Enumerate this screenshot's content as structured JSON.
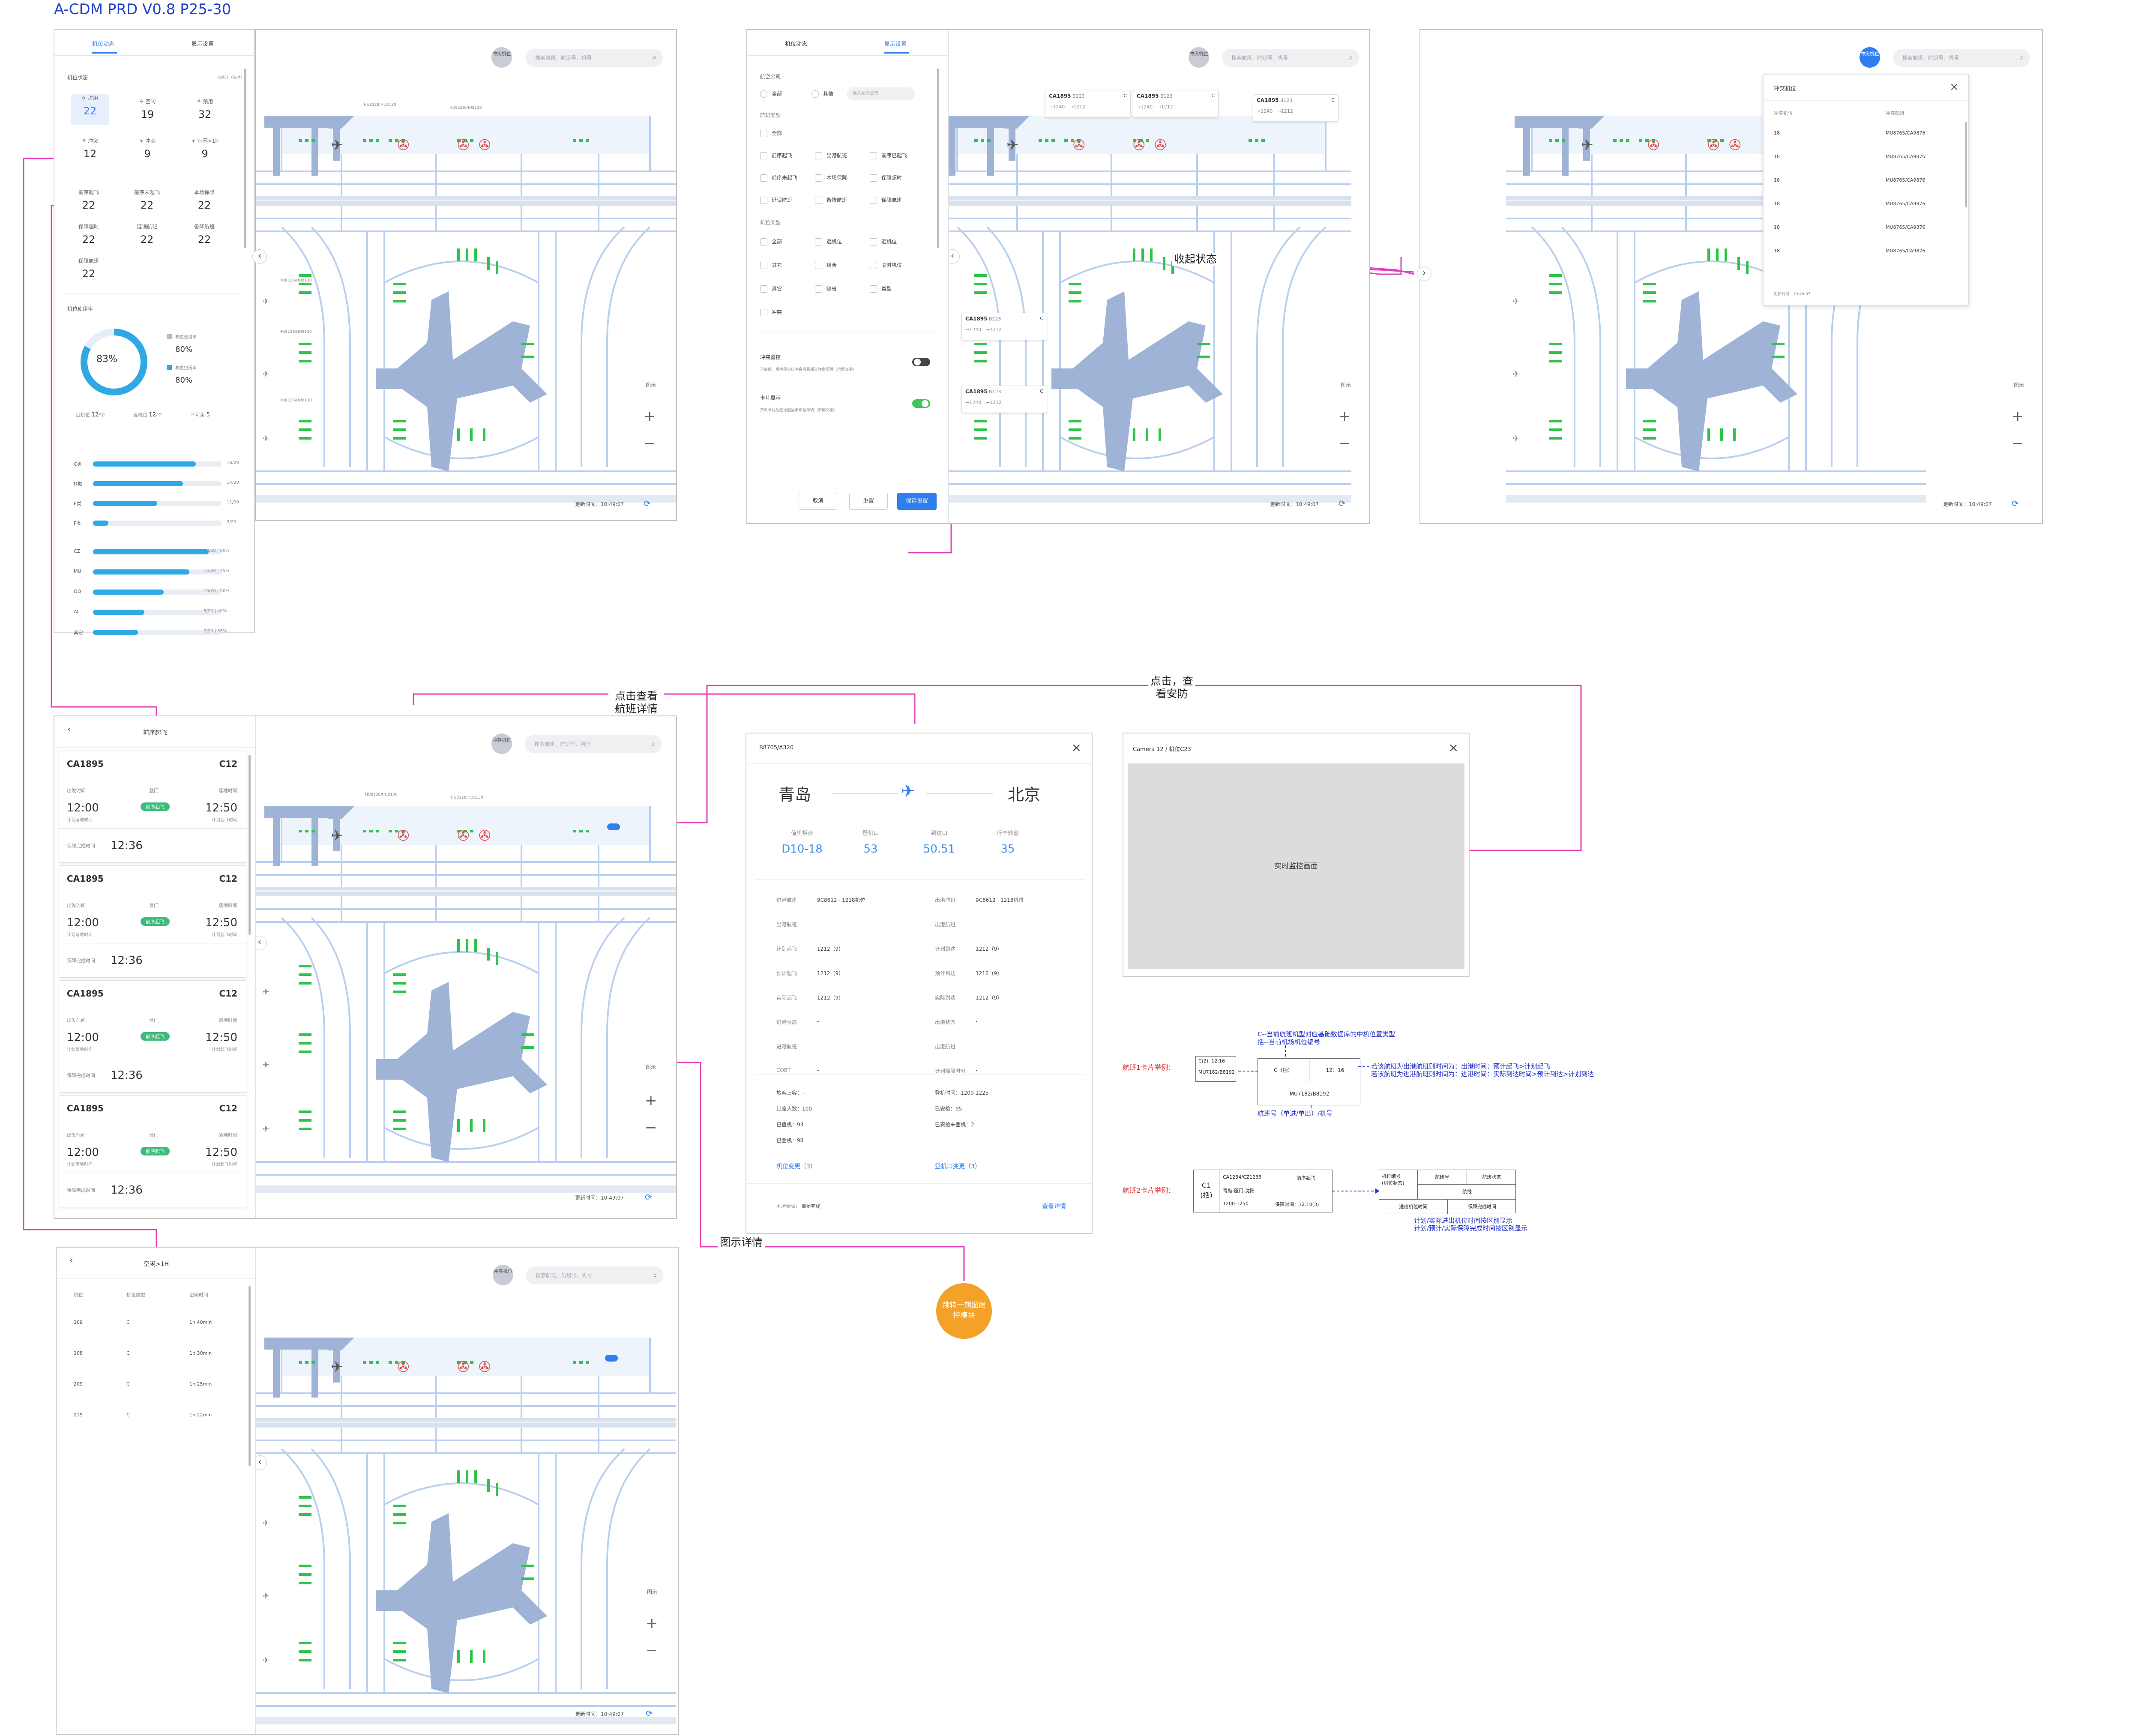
{
  "page_title": "A-CDM PRD V0.8  P25-30",
  "common": {
    "search_placeholder": "搜索航班、航班号、机号",
    "avatar": "冲突机位",
    "legend": "图示",
    "zoom_in": "+",
    "zoom_out": "−",
    "update_label": "更新时间：10:49:07",
    "collapse": "‹",
    "expand": "›"
  },
  "map_labels": [
    "HU8128/HU8130",
    "HU8128/HU8130",
    "HU8128/HU8130",
    "HU8128/HU8130",
    "HU8128/HU8130",
    "HU8128/HU8130",
    "HU8128/HU8130"
  ],
  "panel1": {
    "tabs": [
      "机位动态",
      "显示设置"
    ],
    "section1": "机位状态",
    "section1_hint": "仅统计（实时）",
    "stand_stats": [
      {
        "label": "占用",
        "value": "22",
        "active": true
      },
      {
        "label": "空闲",
        "value": "19"
      },
      {
        "label": "预用",
        "value": "32"
      },
      {
        "label": "冲突",
        "value": "12"
      },
      {
        "label": "冲突",
        "value": "9"
      },
      {
        "label": "空闲>1h",
        "value": "9"
      }
    ],
    "flight_stats": [
      {
        "label": "前序起飞",
        "value": "22"
      },
      {
        "label": "前序未起飞",
        "value": "22"
      },
      {
        "label": "本场保障",
        "value": "22"
      },
      {
        "label": "保障超时",
        "value": "22"
      },
      {
        "label": "延误航班",
        "value": "22"
      },
      {
        "label": "备降航班",
        "value": "22"
      },
      {
        "label": "保障航班",
        "value": "22"
      }
    ],
    "usage_title": "机位使用率",
    "usage_pct": "83%",
    "usage_fraction": 0.83,
    "legend_a_label": "机位使用率",
    "legend_a_value": "80%",
    "legend_b_label": "机位空闲率",
    "legend_b_value": "80%",
    "counts": [
      {
        "label": "近机位",
        "value": "12"
      },
      {
        "label": "远机位",
        "value": "12"
      },
      {
        "label": "不可用",
        "value": "5"
      }
    ],
    "counts_unit": "/个",
    "types": [
      {
        "name": "C类",
        "value": "16/20",
        "fraction": 0.8
      },
      {
        "name": "D类",
        "value": "14/20",
        "fraction": 0.7
      },
      {
        "name": "E类",
        "value": "11/20",
        "fraction": 0.5
      },
      {
        "name": "F类",
        "value": "3/20",
        "fraction": 0.12
      }
    ],
    "airlines": [
      {
        "name": "CZ",
        "value": "18/20 | 90%",
        "fraction": 0.9
      },
      {
        "name": "MU",
        "value": "15/20 | 75%",
        "fraction": 0.75
      },
      {
        "name": "OQ",
        "value": "10/20 | 50%",
        "fraction": 0.55
      },
      {
        "name": "AI",
        "value": "8/20 | 40%",
        "fraction": 0.4
      },
      {
        "name": "其它",
        "value": "7/20 | 35%",
        "fraction": 0.35
      }
    ]
  },
  "panel2": {
    "tabs": [
      "机位动态",
      "显示设置"
    ],
    "airline_label": "航空公司",
    "airline_opts": [
      "全部",
      "其他"
    ],
    "airline_input": "输入航空公司",
    "flight_type_label": "航班类型",
    "flight_opts": [
      "全部",
      "前序起飞",
      "出港航班",
      "前序已起飞",
      "前序未起飞",
      "本场保障",
      "保障超时",
      "延误航班",
      "备降航班",
      "保障航班"
    ],
    "stand_type_label": "机位类型",
    "stand_opts": [
      "全部",
      "远机位",
      "近机位",
      "其它",
      "组合",
      "临时机位",
      "其它",
      "缺省",
      "类型",
      "冲突"
    ],
    "conflict_label": "冲突监控",
    "conflict_desc": "开启后，当检测机位冲突后将通过弹窗提醒（示例文字）",
    "card_label": "卡片显示",
    "card_desc": "开启卡片后在地图显示机位详情（示例文案）",
    "btn_cancel": "取消",
    "btn_reset": "重置",
    "btn_save": "保存设置"
  },
  "flight_popups": [
    {
      "flight": "CA1895",
      "sub": "B123",
      "gate": "C",
      "a": "1240",
      "b": "1212"
    },
    {
      "flight": "CA1895",
      "sub": "B123",
      "gate": "C",
      "a": "1240",
      "b": "1212"
    },
    {
      "flight": "CA1895",
      "sub": "B123",
      "gate": "C",
      "a": "1240",
      "b": "1212"
    },
    {
      "flight": "CA1895",
      "sub": "B123",
      "gate": "C",
      "a": "1240",
      "b": "1212"
    },
    {
      "flight": "CA1895",
      "sub": "B123",
      "gate": "C",
      "a": "1240",
      "b": "1212"
    }
  ],
  "note_collapse": "收起状态",
  "conflict_dialog": {
    "title": "冲突机位",
    "headers": [
      "冲突机位",
      "冲突航班"
    ],
    "rows": [
      [
        "18",
        "MU8765/CA9876"
      ],
      [
        "18",
        "MU8765/CA9876"
      ],
      [
        "18",
        "MU8765/CA9876"
      ],
      [
        "18",
        "MU8765/CA9876"
      ],
      [
        "18",
        "MU8765/CA9876"
      ],
      [
        "18",
        "MU8765/CA9876"
      ]
    ],
    "footer": "更新时间：10:49:07"
  },
  "panel3": {
    "title": "前序起飞",
    "cards": [
      {
        "flight": "CA1895",
        "gate": "C12",
        "l1": "出发时间",
        "l2": "登门",
        "l3": "落地时间",
        "t1": "12:00",
        "t2": "12:50",
        "status": "前序起飞",
        "s1": "计划落地时间",
        "s2": "计划起飞时间",
        "el": "保障完成时间",
        "ev": "12:36"
      },
      {
        "flight": "CA1895",
        "gate": "C12",
        "l1": "出发时间",
        "l2": "登门",
        "l3": "落地时间",
        "t1": "12:00",
        "t2": "12:50",
        "status": "前序起飞",
        "s1": "计划落地时间",
        "s2": "计划起飞时间",
        "el": "保障完成时间",
        "ev": "12:36"
      },
      {
        "flight": "CA1895",
        "gate": "C12",
        "l1": "出发时间",
        "l2": "登门",
        "l3": "落地时间",
        "t1": "12:00",
        "t2": "12:50",
        "status": "前序起飞",
        "s1": "计划落地时间",
        "s2": "计划起飞时间",
        "el": "保障完成时间",
        "ev": "12:36"
      },
      {
        "flight": "CA1895",
        "gate": "C12",
        "l1": "出发时间",
        "l2": "登门",
        "l3": "落地时间",
        "t1": "12:00",
        "t2": "12:50",
        "status": "前序起飞",
        "s1": "计划落地时间",
        "s2": "计划起飞时间",
        "el": "保障完成时间",
        "ev": "12:36"
      }
    ]
  },
  "note_flight_detail": "点击查看\n航班详情",
  "note_security": "点击，查\n看安防",
  "flight_detail": {
    "title": "B8765/A320",
    "from": "青岛",
    "to": "北京",
    "metrics": [
      {
        "label": "值机柜台",
        "value": "D10-18"
      },
      {
        "label": "登机口",
        "value": "53"
      },
      {
        "label": "到达口",
        "value": "50.51"
      },
      {
        "label": "行李转盘",
        "value": "35"
      }
    ],
    "left_fields": [
      {
        "k": "进港航班",
        "v": "9C8612 · 1218机位"
      },
      {
        "k": "出港航班",
        "v": "-"
      },
      {
        "k": "计划起飞",
        "v": "1212（9）"
      },
      {
        "k": "预计起飞",
        "v": "1212（9）"
      },
      {
        "k": "实际起飞",
        "v": "1212（9）"
      },
      {
        "k": "进港状态",
        "v": "-"
      },
      {
        "k": "进港航班",
        "v": "-"
      },
      {
        "k": "COBT",
        "v": "-"
      }
    ],
    "right_fields": [
      {
        "k": "出港航班",
        "v": "9C8612 · 1218机位"
      },
      {
        "k": "出港航班",
        "v": "-"
      },
      {
        "k": "计划到达",
        "v": "1212（9）"
      },
      {
        "k": "预计到达",
        "v": "1212（9）"
      },
      {
        "k": "实际到达",
        "v": "1212（9）"
      },
      {
        "k": "出港状态",
        "v": "-"
      },
      {
        "k": "出港航班",
        "v": "-"
      },
      {
        "k": "计划保障时分",
        "v": "-"
      }
    ],
    "pax_left": [
      "旅客上客：--",
      "订座人数：100",
      "已值机：93",
      "已登机：98"
    ],
    "pax_right": [
      "登机时间：1200-1225",
      "已安检：95",
      "已安检未登机：2"
    ],
    "link_left": "机位变更（3）",
    "link_right": "登机口变更（3）",
    "footer_left_label": "本场保障：",
    "footer_left_value": "离桥完成",
    "footer_right": "查看详情"
  },
  "camera": {
    "title": "Camera 12 / 机位C23",
    "placeholder": "实时监控画面"
  },
  "examples": {
    "ann_top": "C--当前航班机型对应基础数据库的中机位置类型\n括--当前机场机位编号",
    "label1": "航班1卡片举例：",
    "c1_l1": "C(2)",
    "c1_l2": "12:16",
    "c1_l3": "MU7182/B8192",
    "c1_gate": "C（括）",
    "c1_time": "12：16",
    "c1_bottom": "MU7182/B8192",
    "ann_right": "若该航班为出港航班则时间为：出港时间：预计起飞>计划起飞\n若该航班为进港航班则时间为：进港时间：实际到达时间>预计到达>计划到达",
    "ann_bottom": "航班号（单进/单出）/机号",
    "label2": "航班2卡片举例：",
    "c2_gate": "C1\n(括)",
    "c2_flight": "CA1234/CZ1235",
    "c2_status": "前序起飞",
    "c2_route": "青岛-厦门-沈阳",
    "c2_time": "1200-1250",
    "c2_guarantee": "保障时间：12:10(3)",
    "t2_cells": [
      "机位编号\n(机位状态)",
      "航班号",
      "航班状态",
      "航线",
      "进出机位时间",
      "保障完成时间"
    ],
    "ann_bottom2": "计划/实际进出机位时间按区别显示\n计划/预计/实际保障完成时间按区别显示"
  },
  "panel4": {
    "title": "空闲>1H",
    "headers": [
      "机位",
      "机位类型",
      "空闲时间"
    ],
    "rows": [
      [
        "109",
        "C",
        "1h 40min"
      ],
      [
        "108",
        "C",
        "1h 30min"
      ],
      [
        "209",
        "C",
        "1h 25min"
      ],
      [
        "219",
        "C",
        "1h 22min"
      ]
    ]
  },
  "note_legend_detail": "图示详情",
  "note_circle": "跳转一期图层\n控模块"
}
